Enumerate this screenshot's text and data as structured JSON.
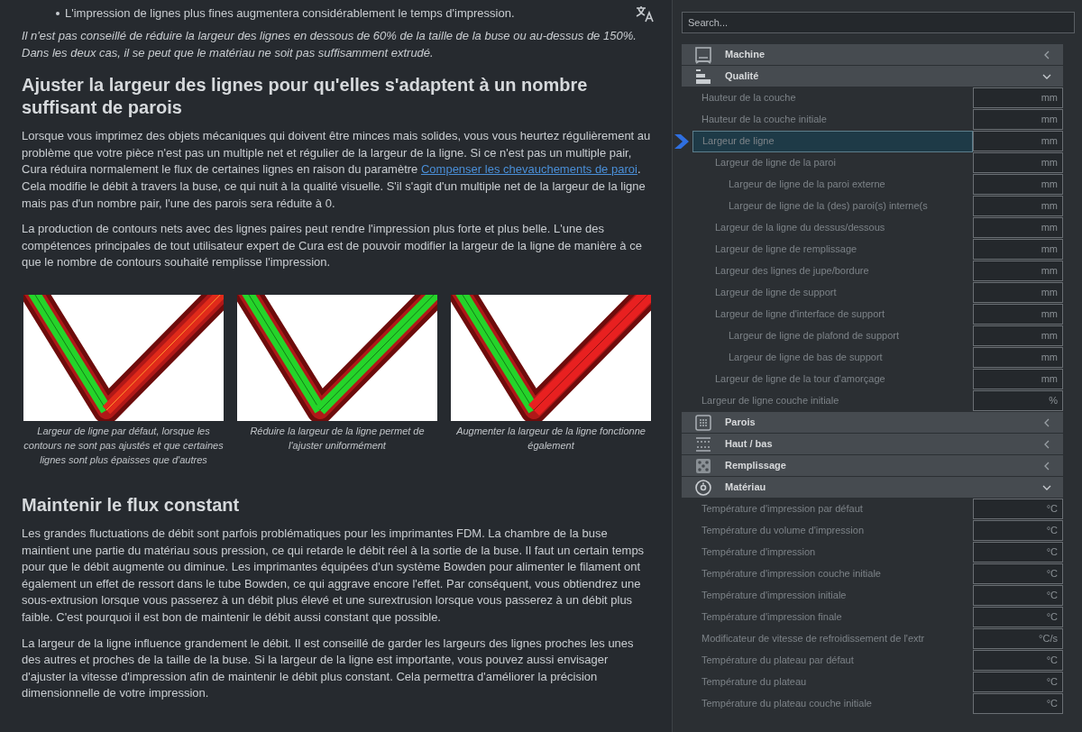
{
  "article": {
    "bullets": [
      "L'impression de lignes plus fines augmentera considérablement le temps d'impression."
    ],
    "note": "Il n'est pas conseillé de réduire la largeur des lignes en dessous de 60% de la taille de la buse ou au-dessus de 150%. Dans les deux cas, il se peut que le matériau ne soit pas suffisamment extrudé.",
    "sections": [
      {
        "heading": "Ajuster la largeur des lignes pour qu'elles s'adaptent à un nombre suffisant de parois",
        "paragraphs": [
          [
            {
              "kind": "text",
              "text": "Lorsque vous imprimez des objets mécaniques qui doivent être minces mais solides, vous vous heurtez régulièrement au problème que votre pièce n'est pas un multiple net et régulier de la largeur de la ligne. Si ce n'est pas un multiple pair, Cura réduira normalement le flux de certaines lignes en raison du paramètre "
            },
            {
              "kind": "link",
              "text": "Compenser les chevauchements de paroi"
            },
            {
              "kind": "text",
              "text": ". Cela modifie le débit à travers la buse, ce qui nuit à la qualité visuelle. S'il s'agit d'un multiple net de la largeur de la ligne mais pas d'un nombre pair, l'une des parois sera réduite à 0."
            }
          ],
          [
            {
              "kind": "text",
              "text": "La production de contours nets avec des lignes paires peut rendre l'impression plus forte et plus belle. L'une des compétences principales de tout utilisateur expert de Cura est de pouvoir modifier la largeur de la ligne de manière à ce que le nombre de contours souhaité remplisse l'impression."
            }
          ]
        ],
        "figures": [
          {
            "caption": "Largeur de ligne par défaut, lorsque les contours ne sont pas ajustés et que certaines lignes sont plus épaisses que d'autres"
          },
          {
            "caption": "Réduire la largeur de la ligne permet de l'ajuster uniformément"
          },
          {
            "caption": "Augmenter la largeur de la ligne fonctionne également"
          }
        ]
      },
      {
        "heading": "Maintenir le flux constant",
        "paragraphs": [
          [
            {
              "kind": "text",
              "text": "Les grandes fluctuations de débit sont parfois problématiques pour les imprimantes FDM. La chambre de la buse maintient une partie du matériau sous pression, ce qui retarde le débit réel à la sortie de la buse. Il faut un certain temps pour que le débit augmente ou diminue. Les imprimantes équipées d'un système Bowden pour alimenter le filament ont également un effet de ressort dans le tube Bowden, ce qui aggrave encore l'effet. Par conséquent, vous obtiendrez une sous-extrusion lorsque vous passerez à un débit plus élevé et une surextrusion lorsque vous passerez à un débit plus faible. C'est pourquoi il est bon de maintenir le débit aussi constant que possible."
            }
          ],
          [
            {
              "kind": "text",
              "text": "La largeur de la ligne influence grandement le débit. Il est conseillé de garder les largeurs des lignes proches les unes des autres et proches de la taille de la buse. Si la largeur de la ligne est importante, vous pouvez aussi envisager d'ajuster la vitesse d'impression afin de maintenir le débit plus constant. Cela permettra d'améliorer la précision dimensionnelle de votre impression."
            }
          ]
        ]
      }
    ]
  },
  "settings_panel": {
    "search": {
      "placeholder": "Search..."
    },
    "categories": [
      {
        "label": "Machine",
        "expanded": false
      },
      {
        "label": "Qualité",
        "expanded": true,
        "settings": [
          {
            "label": "Hauteur de la couche",
            "unit": "mm",
            "selected": false
          },
          {
            "label": "Hauteur de la couche initiale",
            "unit": "mm",
            "selected": false
          },
          {
            "label": "Largeur de ligne",
            "unit": "mm",
            "selected": true,
            "children": [
              {
                "label": "Largeur de ligne de la paroi",
                "unit": "mm",
                "selected": false,
                "children": [
                  {
                    "label": "Largeur de ligne de la paroi externe",
                    "unit": "mm",
                    "selected": false
                  },
                  {
                    "label": "Largeur de ligne de la (des) paroi(s) interne(s",
                    "unit": "mm",
                    "selected": false
                  }
                ]
              },
              {
                "label": "Largeur de la ligne du dessus/dessous",
                "unit": "mm",
                "selected": false
              },
              {
                "label": "Largeur de ligne de remplissage",
                "unit": "mm",
                "selected": false
              },
              {
                "label": "Largeur des lignes de jupe/bordure",
                "unit": "mm",
                "selected": false
              },
              {
                "label": "Largeur de ligne de support",
                "unit": "mm",
                "selected": false
              },
              {
                "label": "Largeur de ligne d'interface de support",
                "unit": "mm",
                "selected": false,
                "children": [
                  {
                    "label": "Largeur de ligne de plafond de support",
                    "unit": "mm",
                    "selected": false
                  },
                  {
                    "label": "Largeur de ligne de bas de support",
                    "unit": "mm",
                    "selected": false
                  }
                ]
              },
              {
                "label": "Largeur de ligne de la tour d'amorçage",
                "unit": "mm",
                "selected": false
              }
            ]
          },
          {
            "label": "Largeur de ligne couche initiale",
            "unit": "%",
            "selected": false
          }
        ]
      },
      {
        "label": "Parois",
        "expanded": false
      },
      {
        "label": "Haut / bas",
        "expanded": false
      },
      {
        "label": "Remplissage",
        "expanded": false
      },
      {
        "label": "Matériau",
        "expanded": true,
        "settings": [
          {
            "label": "Température d'impression par défaut",
            "unit": "°C",
            "selected": false
          },
          {
            "label": "Température du volume d'impression",
            "unit": "°C",
            "selected": false
          },
          {
            "label": "Température d'impression",
            "unit": "°C",
            "selected": false
          },
          {
            "label": "Température d'impression couche initiale",
            "unit": "°C",
            "selected": false
          },
          {
            "label": "Température d'impression initiale",
            "unit": "°C",
            "selected": false
          },
          {
            "label": "Température d'impression finale",
            "unit": "°C",
            "selected": false
          },
          {
            "label": "Modificateur de vitesse de refroidissement de l'extr",
            "unit": "°C/s",
            "selected": false
          },
          {
            "label": "Température du plateau par défaut",
            "unit": "°C",
            "selected": false
          },
          {
            "label": "Température du plateau",
            "unit": "°C",
            "selected": false
          },
          {
            "label": "Température du plateau couche initiale",
            "unit": "°C",
            "selected": false
          }
        ]
      }
    ]
  }
}
